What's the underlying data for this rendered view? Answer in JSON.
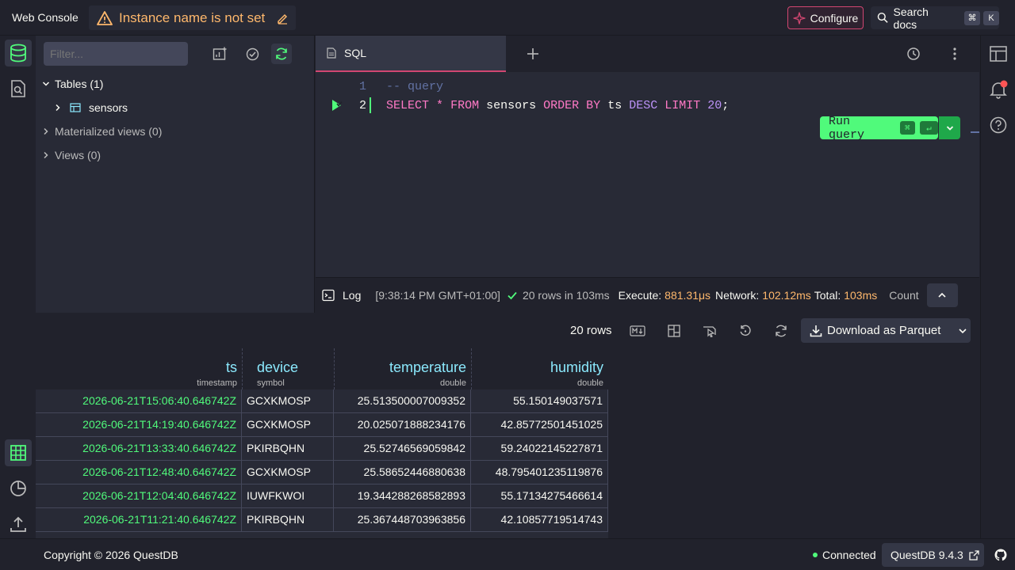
{
  "header": {
    "brand": "Web Console",
    "instance_warning": "Instance name is not set",
    "configure_label": "Configure",
    "search_label": "Search docs",
    "shortcut_cmd": "⌘",
    "shortcut_key": "K"
  },
  "schema": {
    "filter_placeholder": "Filter...",
    "tables_label": "Tables (1)",
    "table_name": "sensors",
    "mat_views_label": "Materialized views (0)",
    "views_label": "Views (0)"
  },
  "editor": {
    "tab_label": "SQL",
    "lines": [
      {
        "num": "1",
        "text": "-- query"
      },
      {
        "num": "2",
        "text": "SELECT * FROM sensors ORDER BY ts DESC LIMIT 20;"
      }
    ],
    "run_label": "Run query",
    "run_cmd": "⌘",
    "run_enter": "↵"
  },
  "log": {
    "label": "Log",
    "time": "[9:38:14 PM GMT+01:00]",
    "summary": "20 rows in 103ms",
    "execute_label": "Execute:",
    "execute_value": "881.31μs",
    "network_label": "Network:",
    "network_value": "102.12ms",
    "total_label": "Total:",
    "total_value": "103ms",
    "count_label": "Count"
  },
  "results": {
    "row_count": "20 rows",
    "download_label": "Download as Parquet",
    "columns": [
      {
        "name": "ts",
        "type": "timestamp"
      },
      {
        "name": "device",
        "type": "symbol"
      },
      {
        "name": "temperature",
        "type": "double"
      },
      {
        "name": "humidity",
        "type": "double"
      }
    ],
    "rows": [
      [
        "2026-06-21T15:06:40.646742Z",
        "GCXKMOSP",
        "25.513500007009352",
        "55.150149037571"
      ],
      [
        "2026-06-21T14:19:40.646742Z",
        "GCXKMOSP",
        "20.025071888234176",
        "42.85772501451025"
      ],
      [
        "2026-06-21T13:33:40.646742Z",
        "PKIRBQHN",
        "25.52746569059842",
        "59.24022145227871"
      ],
      [
        "2026-06-21T12:48:40.646742Z",
        "GCXKMOSP",
        "25.58652446880638",
        "48.795401235119876"
      ],
      [
        "2026-06-21T12:04:40.646742Z",
        "IUWFKWOI",
        "19.344288268582893",
        "55.17134275466614"
      ],
      [
        "2026-06-21T11:21:40.646742Z",
        "PKIRBQHN",
        "25.367448703963856",
        "42.10857719514743"
      ]
    ]
  },
  "footer": {
    "copyright": "Copyright © 2026 QuestDB",
    "status": "Connected",
    "version": "QuestDB 9.4.3"
  },
  "colors": {
    "accent_pink": "#d14671",
    "green": "#50fa7b",
    "cyan": "#8be9fd",
    "orange": "#ffb86c",
    "keyword_pink": "#ff79c6",
    "purple": "#bd93f9"
  }
}
